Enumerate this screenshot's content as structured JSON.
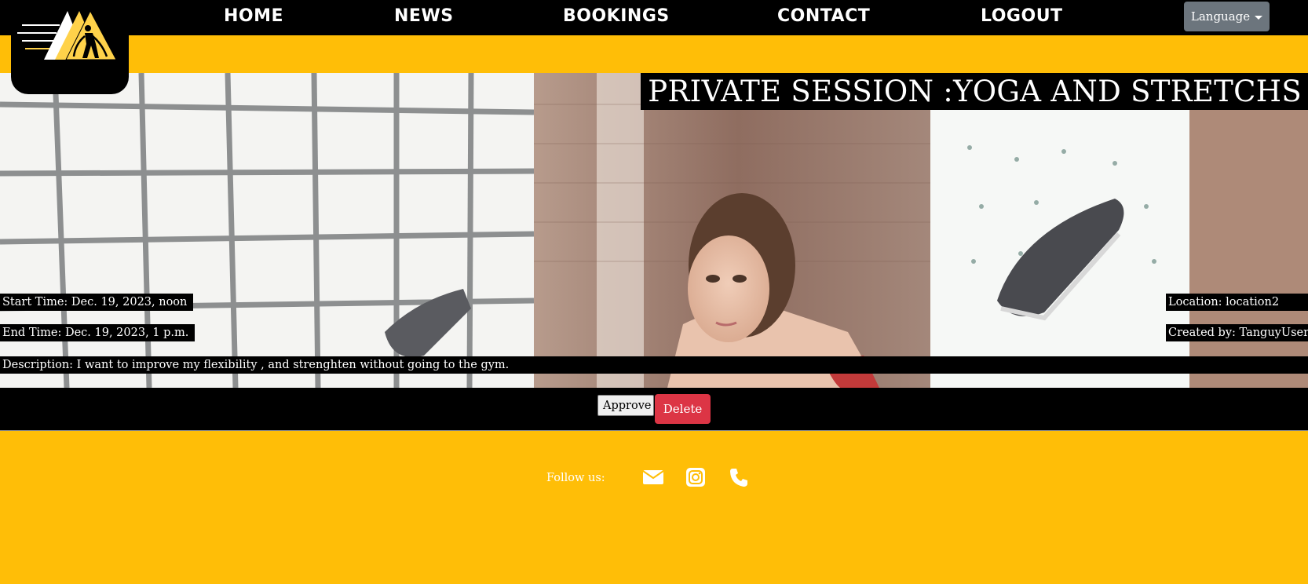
{
  "nav": {
    "items": [
      {
        "label": "HOME"
      },
      {
        "label": "NEWS"
      },
      {
        "label": "BOOKINGS"
      },
      {
        "label": "CONTACT"
      },
      {
        "label": "LOGOUT"
      }
    ],
    "language_label": "Language"
  },
  "session": {
    "title": "PRIVATE SESSION :YOGA AND STRETCHS",
    "start_time": "Start Time: Dec. 19, 2023, noon",
    "end_time": "End Time: Dec. 19, 2023, 1 p.m.",
    "description": "Description: I want to improve my flexibility , and strenghten without going to the gym.",
    "location": "Location: location2",
    "created_by": "Created by: TanguyUser"
  },
  "actions": {
    "approve_label": "Approve",
    "delete_label": "Delete"
  },
  "footer": {
    "follow_label": "Follow us:",
    "icons": [
      "envelope-icon",
      "instagram-icon",
      "phone-icon"
    ]
  },
  "colors": {
    "accent_yellow": "#ffbe07",
    "navbar": "#000000",
    "delete_red": "#dc3545",
    "language_gray": "#6c757d"
  }
}
